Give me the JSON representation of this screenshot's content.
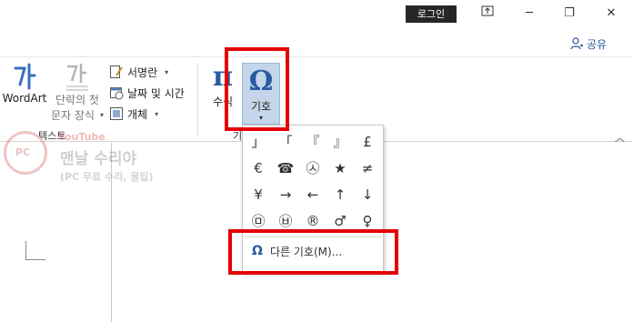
{
  "titlebar": {
    "login_label": "로그인",
    "restore_ribbon_icon": "ribbon-display-icon",
    "minimize_icon": "─",
    "restore_icon": "❐",
    "close_icon": "✕"
  },
  "share": {
    "label": "공유"
  },
  "ribbon": {
    "text_group": {
      "label": "텍스트",
      "wordart_label": "WordArt",
      "dropcap_line1": "단락의 첫",
      "dropcap_line2": "문자 장식",
      "signature_label": "서명란",
      "datetime_label": "날짜 및 시간",
      "object_label": "개체"
    },
    "equation_label": "수식",
    "symbol_label": "기호",
    "symbols_group_label_fragment": "기"
  },
  "watermark": {
    "youtube": "YouTube",
    "title": "맨날 수리야",
    "subtitle": "(PC 무료 수리, 꿀팁)",
    "badge": "PC"
  },
  "symbol_dropdown": {
    "symbols": [
      "」",
      "「",
      "『",
      "』",
      "£",
      "€",
      "☎",
      "㉦",
      "★",
      "≠",
      "¥",
      "→",
      "←",
      "↑",
      "↓",
      "㉤",
      "㉥",
      "®",
      "♂",
      "♀"
    ],
    "more_label": "다른 기호(M)..."
  },
  "colors": {
    "highlight_red": "#e50000",
    "selected_button": "#c5d6ea",
    "accent_blue": "#2b579a"
  }
}
